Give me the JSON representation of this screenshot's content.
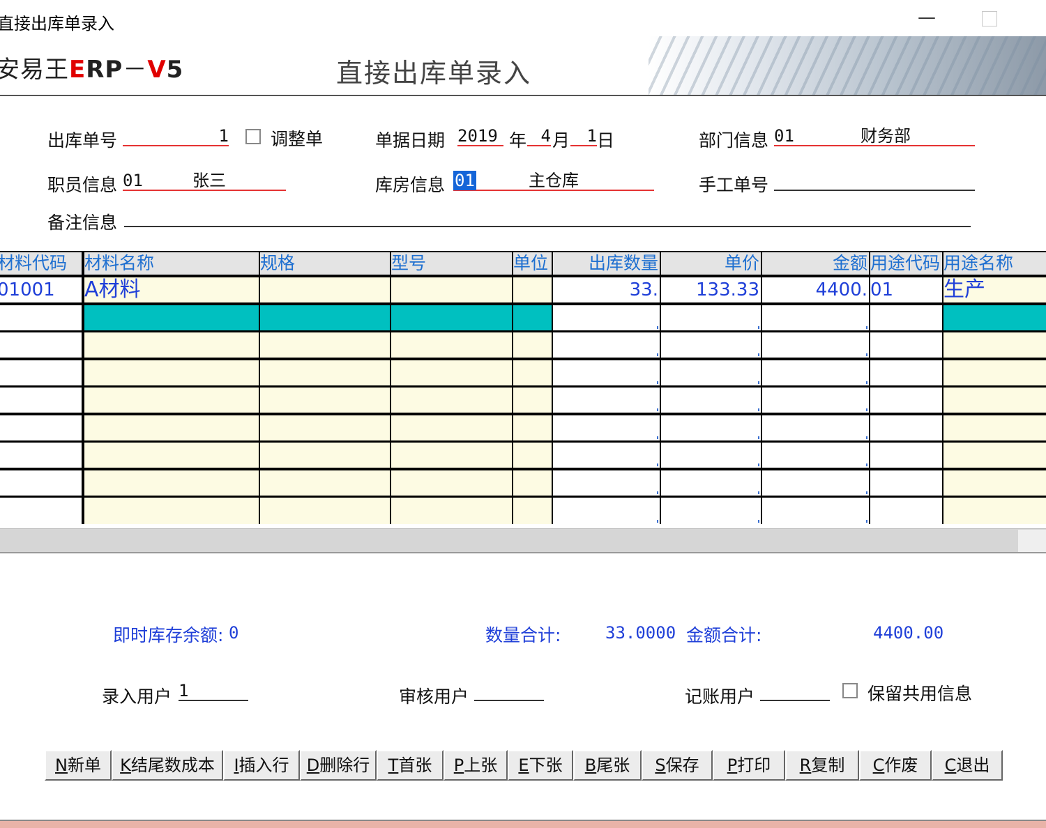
{
  "window": {
    "title": "直接出库单录入",
    "minimize_glyph": "—"
  },
  "banner": {
    "brand_parts": [
      "安易王",
      "E",
      "RP",
      "－",
      "V",
      "5"
    ],
    "heading": "直接出库单录入"
  },
  "form": {
    "out_no_label": "出库单号",
    "out_no_value": "1",
    "adjust_label": "调整单",
    "date_label": "单据日期",
    "year": "2019",
    "year_unit": "年",
    "month": "4",
    "month_unit": "月",
    "day": "1",
    "day_unit": "日",
    "dept_label": "部门信息",
    "dept_code": "01",
    "dept_name": "财务部",
    "staff_label": "职员信息",
    "staff_code": "01",
    "staff_name": "张三",
    "warehouse_label": "库房信息",
    "warehouse_code": "01",
    "warehouse_name": "主仓库",
    "manual_no_label": "手工单号",
    "manual_no_value": "",
    "remark_label": "备注信息",
    "remark_value": ""
  },
  "grid": {
    "columns": [
      "材料代码",
      "材料名称",
      "规格",
      "型号",
      "单位",
      "出库数量",
      "单价",
      "金额",
      "用途代码",
      "用途名称"
    ],
    "rows": [
      [
        "01001",
        "A材料",
        "",
        "",
        "",
        "33.",
        "133.33",
        "4400.",
        "01",
        "生产"
      ]
    ],
    "empty_row_count": 8
  },
  "footer": {
    "stock_balance_label": "即时库存余额:",
    "stock_balance_value": "0",
    "qty_total_label": "数量合计:",
    "qty_total_value": "33.0000",
    "amount_total_label": "金额合计:",
    "amount_total_value": "4400.00",
    "entry_user_label": "录入用户",
    "entry_user_value": "1",
    "audit_user_label": "审核用户",
    "audit_user_value": "",
    "post_user_label": "记账用户",
    "post_user_value": "",
    "keep_shared_label": "保留共用信息"
  },
  "buttons": [
    {
      "key": "N",
      "label": "新单"
    },
    {
      "key": "K",
      "label": "结尾数成本"
    },
    {
      "key": "I",
      "label": "插入行"
    },
    {
      "key": "D",
      "label": "删除行"
    },
    {
      "key": "T",
      "label": "首张"
    },
    {
      "key": "P",
      "label": "上张"
    },
    {
      "key": "E",
      "label": "下张"
    },
    {
      "key": "B",
      "label": "尾张"
    },
    {
      "key": "S",
      "label": "保存"
    },
    {
      "key": "P",
      "label": "打印"
    },
    {
      "key": "R",
      "label": "复制"
    },
    {
      "key": "C",
      "label": "作废"
    },
    {
      "key": "C",
      "label": "退出"
    }
  ],
  "colors": {
    "accent_blue": "#1f3fd8",
    "header_blue": "#1e6fd0",
    "underline_red": "#e53333",
    "row_cream": "#fdfbe3",
    "row_teal": "#00c0c0"
  }
}
